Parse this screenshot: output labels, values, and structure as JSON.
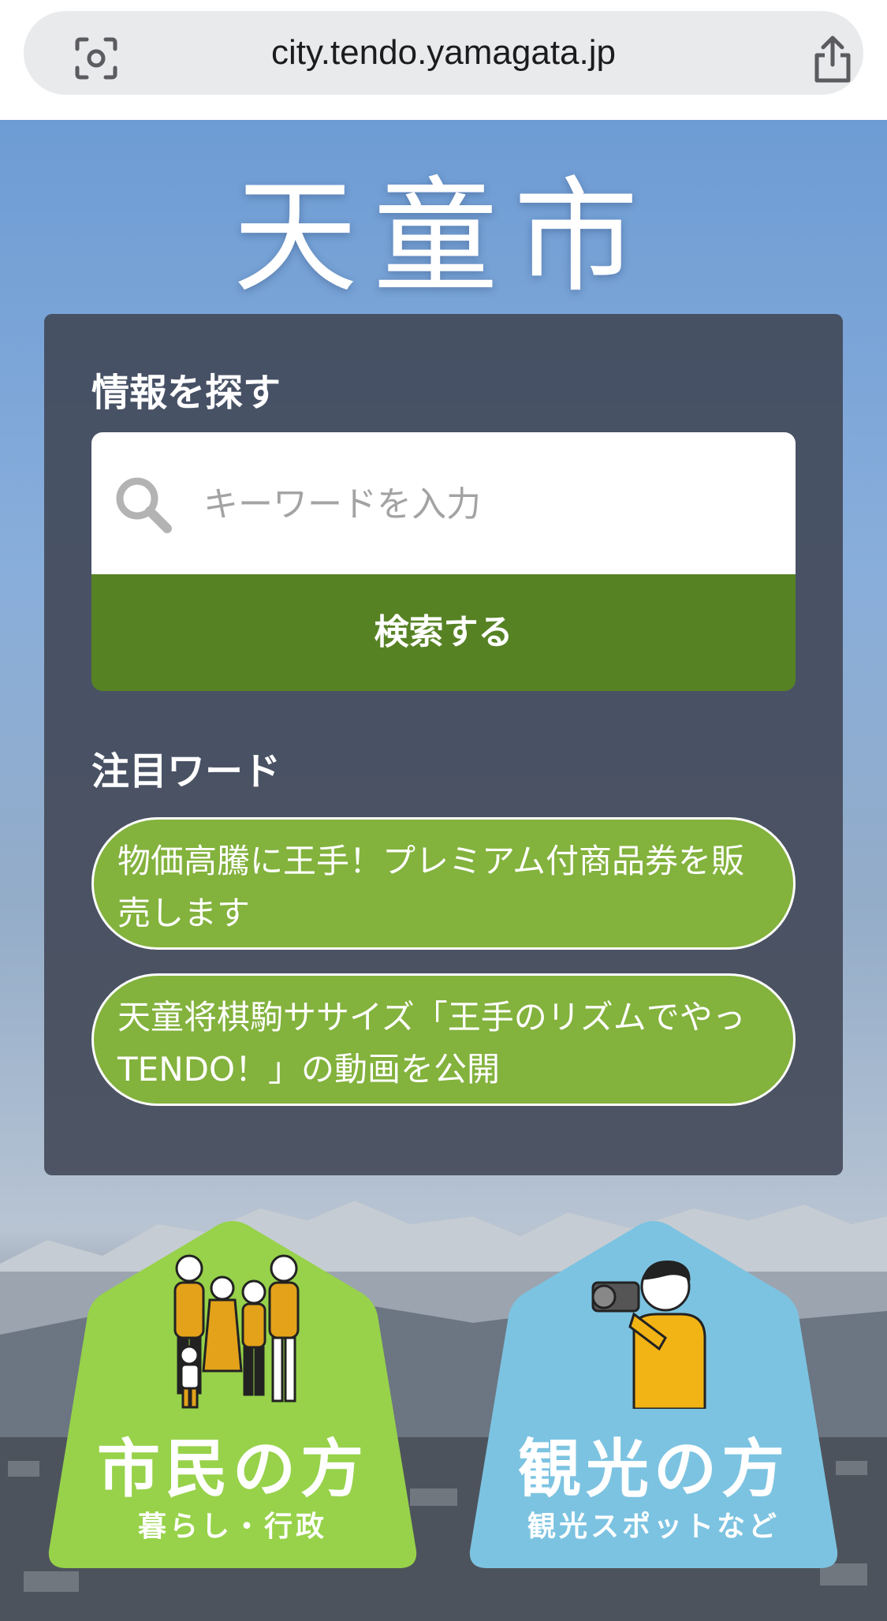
{
  "browser": {
    "url": "city.tendo.yamagata.jp",
    "left_icon": "camera-scan-icon",
    "right_icon": "share-icon"
  },
  "site": {
    "logo_text": "天童市"
  },
  "search": {
    "title": "情報を探す",
    "placeholder": "キーワードを入力",
    "button_label": "検索する",
    "icon": "search-icon",
    "button_color": "#578224"
  },
  "featured": {
    "title": "注目ワード",
    "items": [
      {
        "label": "物価高騰に王手！プレミアム付商品券を販売します"
      },
      {
        "label": "天童将棋駒ササイズ「王手のリズムでやっTENDO！」の動画を公開"
      }
    ],
    "pill_color": "#83b23d"
  },
  "entries": [
    {
      "title": "市民の方",
      "subtitle": "暮らし・行政",
      "color": "#97d24a",
      "illustration": "family-illustration"
    },
    {
      "title": "観光の方",
      "subtitle": "観光スポットなど",
      "color": "#7cc3e1",
      "illustration": "photographer-illustration"
    }
  ]
}
